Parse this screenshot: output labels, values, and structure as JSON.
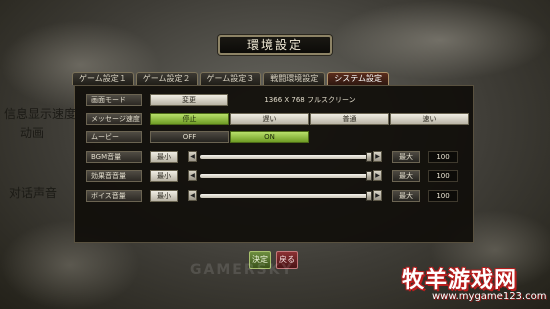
{
  "title": "環境設定",
  "tabs": [
    {
      "label": "ゲーム設定１",
      "active": false
    },
    {
      "label": "ゲーム設定２",
      "active": false
    },
    {
      "label": "ゲーム設定３",
      "active": false
    },
    {
      "label": "戦闘環境設定",
      "active": false
    },
    {
      "label": "システム設定",
      "active": true
    }
  ],
  "screen_mode": {
    "label": "画面モード",
    "change_button": "変更",
    "resolution": "1366  X   768  フルスクリーン"
  },
  "message_speed": {
    "label": "メッセージ速度",
    "options": [
      "停止",
      "遅い",
      "普通",
      "速い"
    ],
    "selected": "停止"
  },
  "movie": {
    "label": "ムービー",
    "off": "OFF",
    "on": "ON",
    "selected": "ON"
  },
  "volumes": [
    {
      "label": "BGM音量",
      "min": "最小",
      "max": "最大",
      "value": "100",
      "level": 1.0
    },
    {
      "label": "効果音音量",
      "min": "最小",
      "max": "最大",
      "value": "100",
      "level": 1.0
    },
    {
      "label": "ボイス音量",
      "min": "最小",
      "max": "最大",
      "value": "100",
      "level": 1.0
    }
  ],
  "footer": {
    "ok": "決定",
    "back": "戻る"
  },
  "annotations": {
    "speed_note": "信息显示速度",
    "anim_note": "动画",
    "sound_note": "对话声音"
  },
  "watermark": {
    "site_name": "牧羊游戏网",
    "url": "www.mygame123.com",
    "mid": "GAMERSKY"
  },
  "colors": {
    "accent_green": "#8fbf3f",
    "tab_active": "#5b2d1d",
    "ok_button": "#4f6b28",
    "back_button": "#6e2224"
  }
}
